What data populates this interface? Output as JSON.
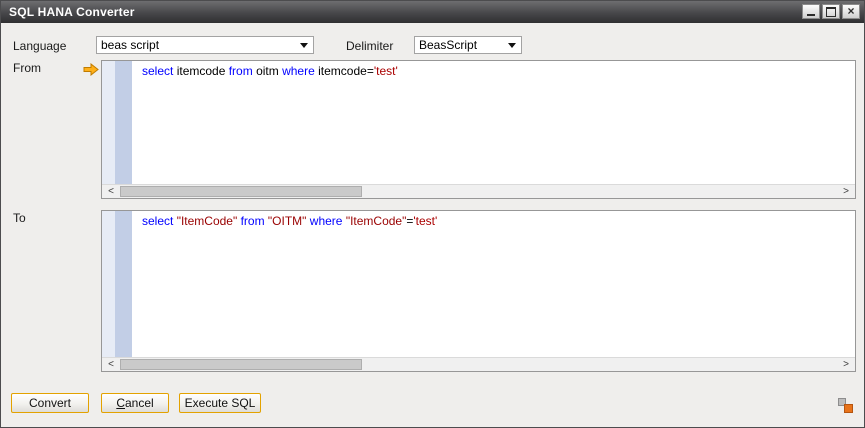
{
  "window": {
    "title": "SQL HANA Converter"
  },
  "icons": {
    "close": "×",
    "scroll_left": "<",
    "scroll_right": ">"
  },
  "form": {
    "language_label": "Language",
    "language_value": "beas script",
    "delimiter_label": "Delimiter",
    "delimiter_value": "BeasScript"
  },
  "from_editor": {
    "label": "From",
    "code": "select itemcode from oitm where itemcode='test'",
    "tokens": [
      {
        "text": "select ",
        "color": "#0000ff"
      },
      {
        "text": "itemcode ",
        "color": "#000000"
      },
      {
        "text": "from ",
        "color": "#0000ff"
      },
      {
        "text": "oitm ",
        "color": "#000000"
      },
      {
        "text": "where ",
        "color": "#0000ff"
      },
      {
        "text": "itemcode",
        "color": "#000000"
      },
      {
        "text": "=",
        "color": "#000000"
      },
      {
        "text": "'test'",
        "color": "#aa0000"
      }
    ]
  },
  "to_editor": {
    "label": "To",
    "code": "select \"ItemCode\" from \"OITM\" where \"ItemCode\"='test'",
    "tokens": [
      {
        "text": "select ",
        "color": "#0000ff"
      },
      {
        "text": "\"ItemCode\" ",
        "color": "#990000"
      },
      {
        "text": "from ",
        "color": "#0000ff"
      },
      {
        "text": "\"OITM\" ",
        "color": "#990000"
      },
      {
        "text": "where ",
        "color": "#0000ff"
      },
      {
        "text": "\"ItemCode\"",
        "color": "#990000"
      },
      {
        "text": "=",
        "color": "#000000"
      },
      {
        "text": "'test'",
        "color": "#aa0000"
      }
    ]
  },
  "buttons": [
    {
      "label": "Convert"
    },
    {
      "label": "Cancel"
    },
    {
      "label": "Execute SQL"
    }
  ],
  "colors": {
    "button_border_gold": "#e3a200",
    "keyword_blue": "#0000ff",
    "string_red": "#aa0000",
    "quoted_identifier_red": "#990000",
    "link_arrow_orange": "#ffb019",
    "titlebar_dark": "#47474a"
  }
}
